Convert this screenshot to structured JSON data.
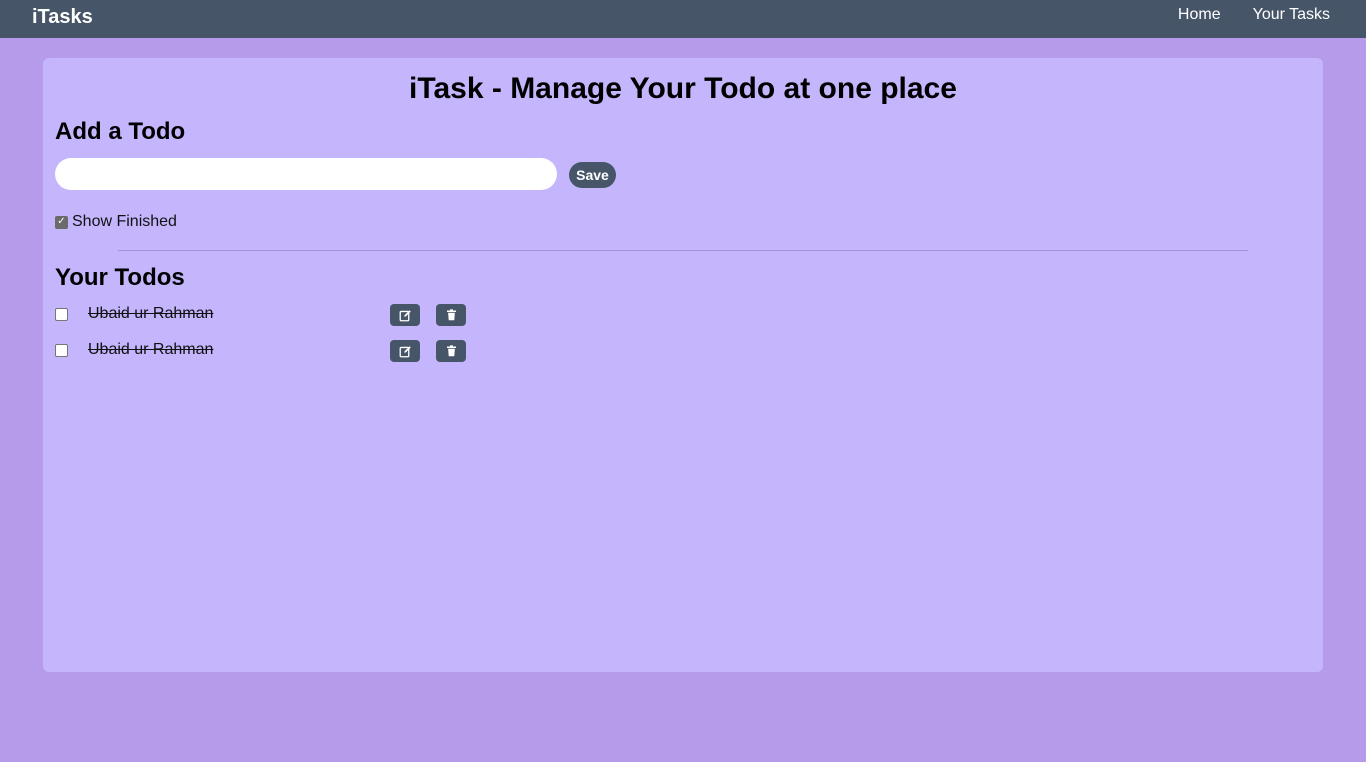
{
  "navbar": {
    "brand": "iTasks",
    "links": [
      {
        "label": "Home"
      },
      {
        "label": "Your Tasks"
      }
    ]
  },
  "main": {
    "page_title": "iTask - Manage Your Todo at one place",
    "add_section": {
      "title": "Add a Todo",
      "input_value": "",
      "save_label": "Save"
    },
    "show_finished": {
      "label": "Show Finished",
      "checked": true
    },
    "todos_section": {
      "title": "Your Todos",
      "items": [
        {
          "text": "Ubaid ur Rahman",
          "completed": false,
          "edit_icon": "edit-icon",
          "delete_icon": "trash-icon"
        },
        {
          "text": "Ubaid ur Rahman",
          "completed": false,
          "edit_icon": "edit-icon",
          "delete_icon": "trash-icon"
        }
      ]
    }
  },
  "colors": {
    "background": "#b59be9",
    "card": "#c4b5fd",
    "navbar": "#475569",
    "button": "#475569"
  }
}
